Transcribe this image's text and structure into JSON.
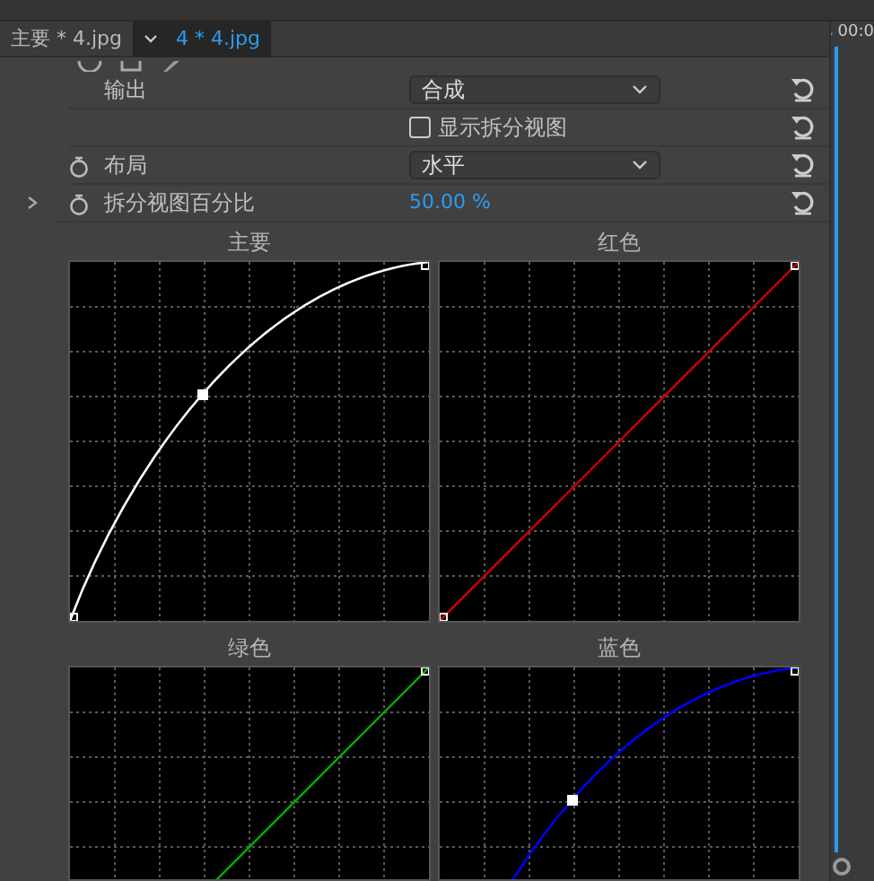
{
  "tabs": [
    {
      "label": "主要 * 4.jpg",
      "selected": false
    },
    {
      "label": "4 * 4.jpg",
      "selected": true,
      "dropdown": true
    }
  ],
  "timeline": {
    "timecode": "00:0"
  },
  "properties": [
    {
      "kind": "select",
      "label": "输出",
      "value": "合成"
    },
    {
      "kind": "checkbox",
      "label": "显示拆分视图",
      "checked": false
    },
    {
      "kind": "select",
      "label": "布局",
      "value": "水平",
      "stopwatch": true
    },
    {
      "kind": "value",
      "label": "拆分视图百分比",
      "value": "50.00 %",
      "stopwatch": true,
      "expandable": true
    }
  ],
  "curves": [
    {
      "title": "主要",
      "color": "#ffffff",
      "kind": "curve"
    },
    {
      "title": "红色",
      "color": "#cc0000",
      "kind": "linear"
    },
    {
      "title": "绿色",
      "color": "#00b000",
      "kind": "linear"
    },
    {
      "title": "蓝色",
      "color": "#0000ff",
      "kind": "curve"
    }
  ]
}
